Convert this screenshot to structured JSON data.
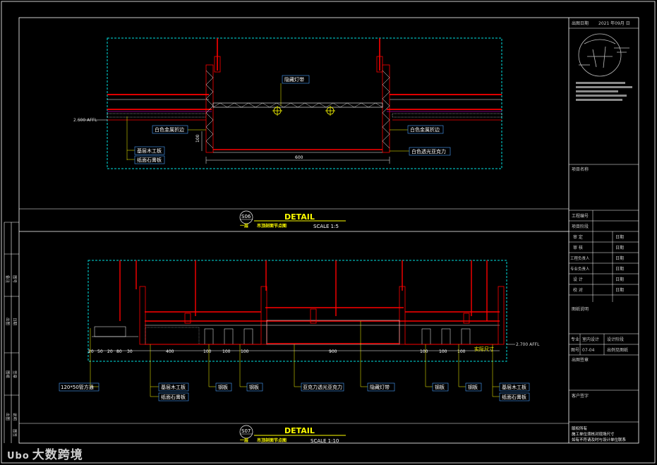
{
  "title_block": {
    "issue_date_label": "出图日期",
    "issue_date_value": "2021 年09月 日",
    "project_name_label": "项目名称",
    "project_no_label": "工程编号",
    "project_phase_label": "项目阶段",
    "roles": [
      {
        "label": "审 定",
        "date": "日期"
      },
      {
        "label": "审 核",
        "date": "日期"
      },
      {
        "label": "工程负责人",
        "date": "日期"
      },
      {
        "label": "专业负责人",
        "date": "日期"
      },
      {
        "label": "设 计",
        "date": "日期"
      },
      {
        "label": "校 对",
        "date": "日期"
      }
    ],
    "drawing_desc_label": "图纸说明",
    "discipline_label": "专业",
    "discipline_value": "室内设计",
    "stage_label": "设计阶段",
    "drawing_no_label": "图号",
    "drawing_no_value": "07-04",
    "drawing_name": "出例见图纸",
    "stamp_label": "出图签章",
    "client_sign_label": "客户签字",
    "notes": [
      "版权所有",
      "施工单位须核对现场尺寸",
      "如有不符请及时与设计单位联系"
    ]
  },
  "left_strip": [
    "备注",
    "图号",
    "出图",
    "日期",
    "图纸",
    "签章",
    "出图",
    "说明",
    "图签"
  ],
  "detail1": {
    "code": "S06",
    "title": "DETAIL",
    "subtitle": "吊顶剖面节点图",
    "subtitle_prefix": "一层",
    "scale": "SCALE 1:5",
    "level": "2.600 AFFL",
    "labels": [
      "隐藏灯带",
      "白色金属折边",
      "白色金属折边",
      "基层木工板",
      "纸面石膏板",
      "白色透光亚克力"
    ],
    "dims": [
      "100",
      "600"
    ]
  },
  "detail2": {
    "code": "S07",
    "title": "DETAIL",
    "subtitle": "吊顶剖面节点图",
    "subtitle_prefix": "一层",
    "scale": "SCALE 1:10",
    "level": "2.700 AFFL",
    "dims": [
      "20",
      "50",
      "20",
      "80",
      "30",
      "400",
      "100",
      "100",
      "100",
      "900",
      "100",
      "100",
      "100"
    ],
    "site_dim": "实际尺寸",
    "labels": [
      "120*50管方通",
      "基层木工板",
      "纸面石膏板",
      "钢板",
      "钢板",
      "亚克力透光亚克力",
      "隐藏灯带",
      "钢板",
      "钢板",
      "基层木工板",
      "纸面石膏板"
    ]
  },
  "watermark": {
    "logo": "Ubo",
    "text": "大数跨境"
  }
}
